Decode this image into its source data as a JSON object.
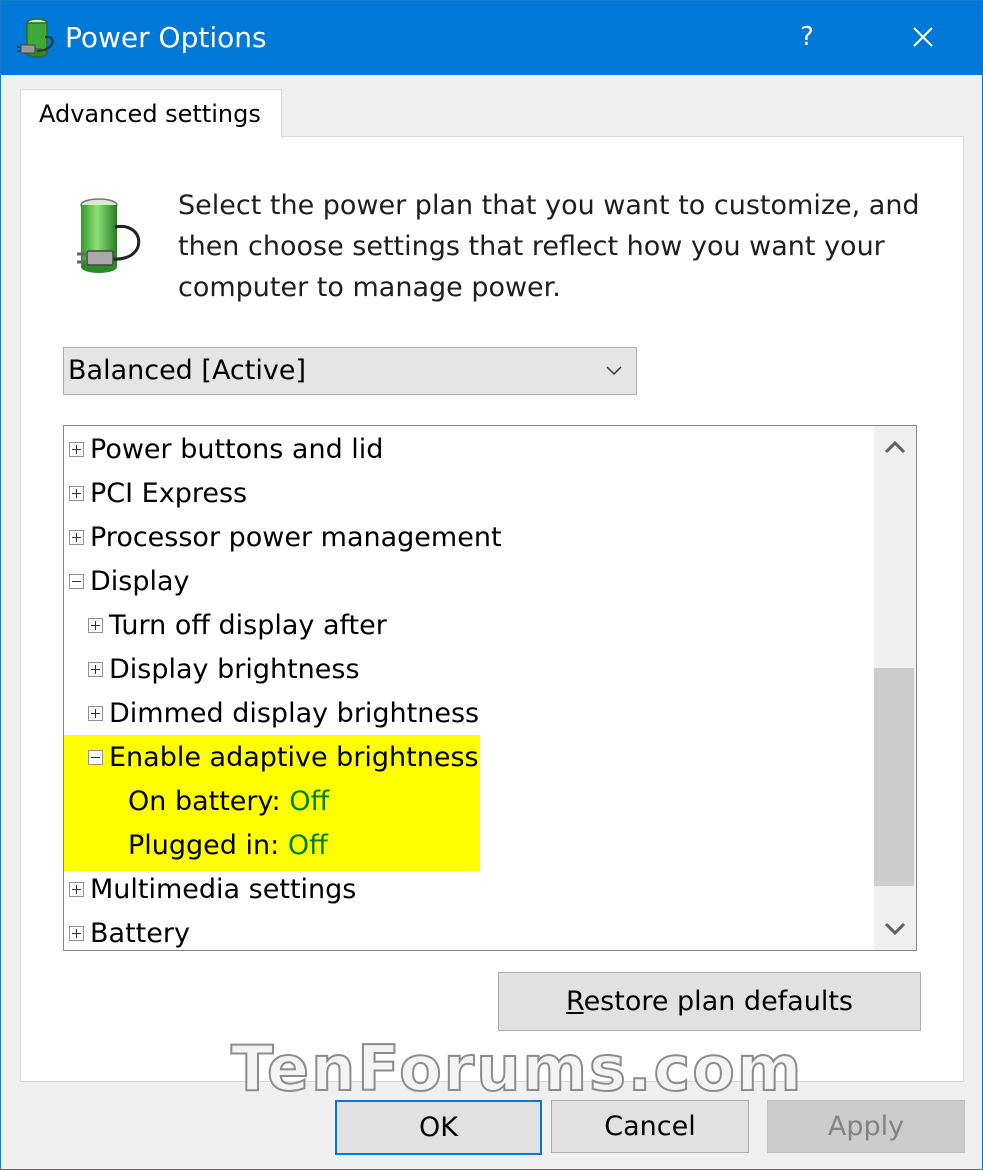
{
  "window": {
    "title": "Power Options",
    "help_glyph": "?",
    "icons": {
      "app": "power-options-icon",
      "close": "close-icon"
    }
  },
  "tab": {
    "label": "Advanced settings"
  },
  "description": "Select the power plan that you want to customize, and then choose settings that reflect how you want your computer to manage power.",
  "plan_selector": {
    "value": "Balanced [Active]"
  },
  "settings_tree": {
    "items": [
      {
        "label": "Power buttons and lid",
        "state": "collapsed"
      },
      {
        "label": "PCI Express",
        "state": "collapsed"
      },
      {
        "label": "Processor power management",
        "state": "collapsed"
      },
      {
        "label": "Display",
        "state": "expanded"
      },
      {
        "label": "Turn off display after",
        "state": "collapsed"
      },
      {
        "label": "Display brightness",
        "state": "collapsed"
      },
      {
        "label": "Dimmed display brightness",
        "state": "collapsed"
      },
      {
        "label": "Enable adaptive brightness",
        "state": "expanded",
        "highlighted": true
      },
      {
        "label": "On battery:",
        "value": "Off",
        "highlighted": true
      },
      {
        "label": "Plugged in:",
        "value": "Off",
        "highlighted": true
      },
      {
        "label": "Multimedia settings",
        "state": "collapsed"
      },
      {
        "label": "Battery",
        "state": "collapsed"
      }
    ]
  },
  "buttons": {
    "restore_prefix": "R",
    "restore_rest": "estore plan defaults",
    "ok": "OK",
    "cancel": "Cancel",
    "apply": "Apply"
  },
  "watermark": "TenForums.com",
  "colors": {
    "titlebar": "#0078d7",
    "highlight": "#ffff00",
    "setting_value": "#008000"
  }
}
